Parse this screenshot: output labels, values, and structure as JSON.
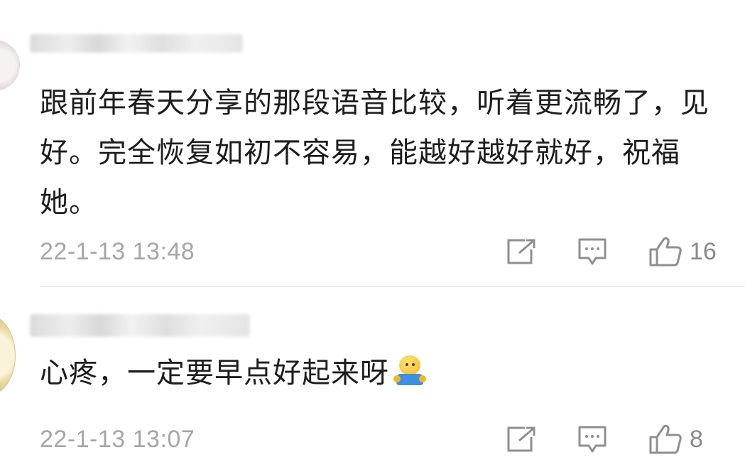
{
  "comments": [
    {
      "username": "",
      "text": "跟前年春天分享的那段语音比较，听着更流畅了，见好。完全恢复如初不容易，能越好越好就好，祝福她。",
      "timestamp": "22-1-13 13:48",
      "likes": "16",
      "emoji": ""
    },
    {
      "username": "",
      "text": "心疼，一定要早点好起来呀",
      "timestamp": "22-1-13 13:07",
      "likes": "8",
      "emoji": "smiling-face-with-open-hands"
    }
  ],
  "icons": {
    "share": "share-icon",
    "comment": "comment-icon",
    "like": "thumbs-up-icon"
  },
  "colors": {
    "text": "#1d1d1d",
    "meta": "#a6a6a6",
    "icon": "#8f8f8f",
    "divider": "#e5e5e5"
  }
}
